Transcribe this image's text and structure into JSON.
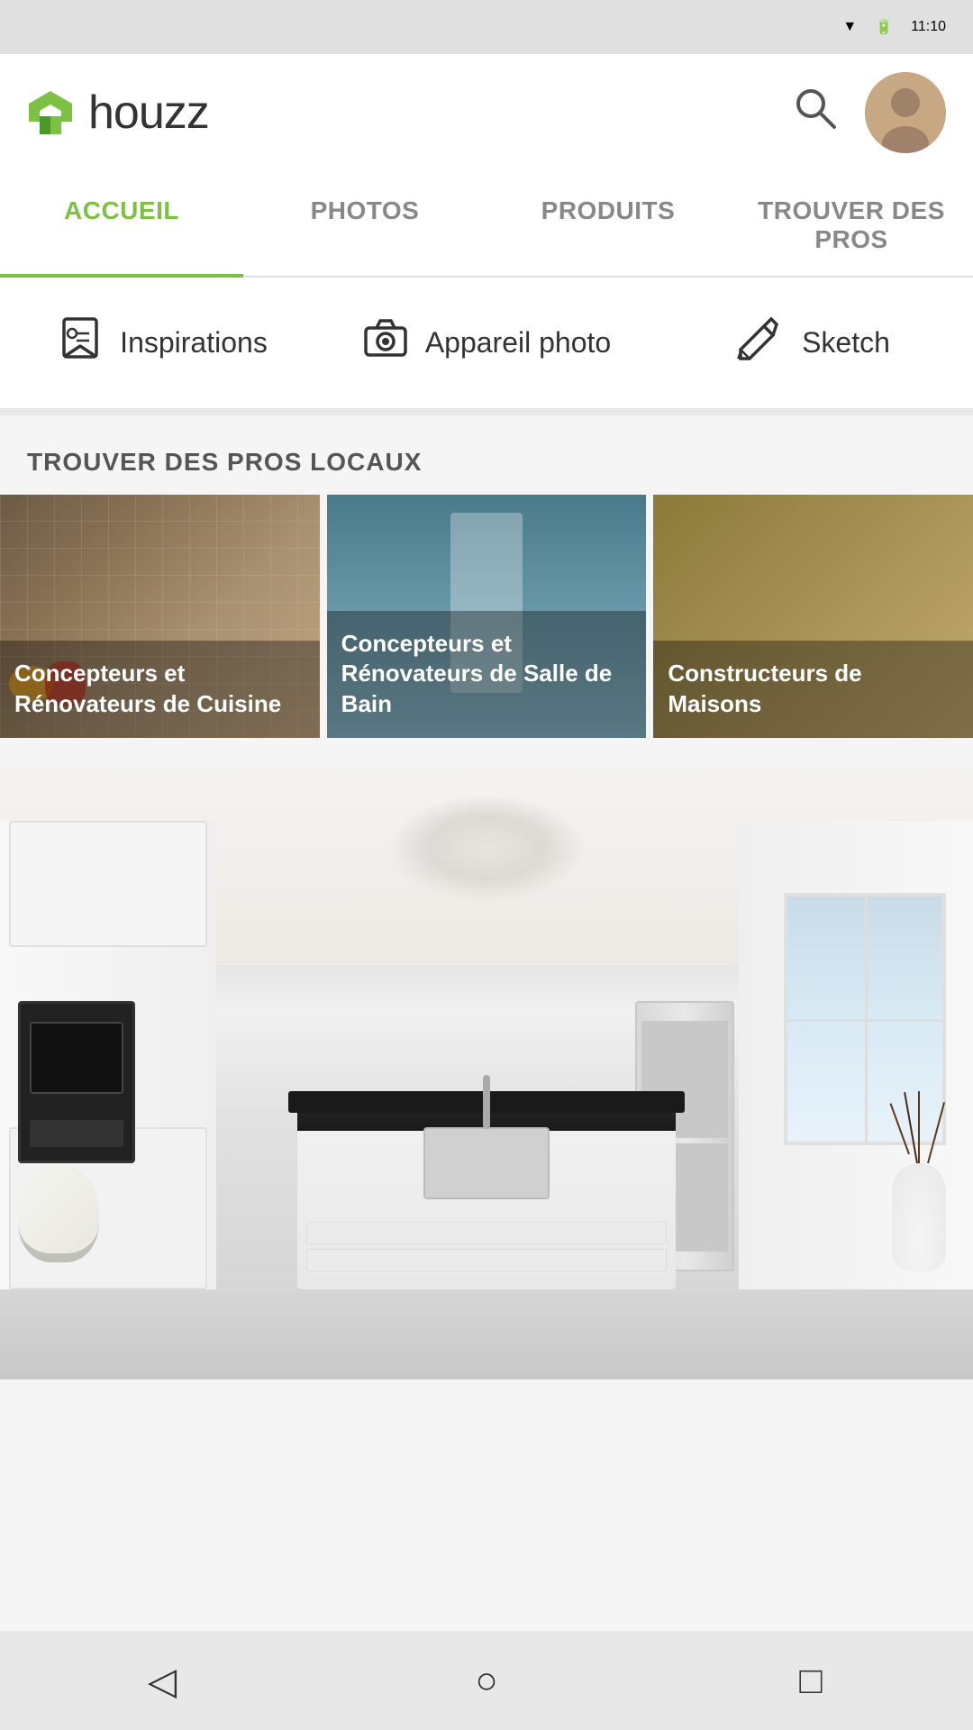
{
  "status_bar": {
    "time": "11:10"
  },
  "header": {
    "logo_text": "houzz",
    "search_icon": "🔍"
  },
  "nav": {
    "tabs": [
      {
        "id": "accueil",
        "label": "ACCUEIL",
        "active": true
      },
      {
        "id": "photos",
        "label": "PHOTOS",
        "active": false
      },
      {
        "id": "produits",
        "label": "PRODUITS",
        "active": false
      },
      {
        "id": "trouver",
        "label": "TROUVER DES PROS",
        "active": false
      }
    ]
  },
  "quick_actions": [
    {
      "id": "inspirations",
      "label": "Inspirations",
      "icon": "bookmark"
    },
    {
      "id": "appareil_photo",
      "label": "Appareil photo",
      "icon": "camera"
    },
    {
      "id": "sketch",
      "label": "Sketch",
      "icon": "pencil"
    }
  ],
  "pros_section": {
    "title": "TROUVER DES PROS LOCAUX",
    "cards": [
      {
        "id": "card1",
        "text": "Concepteurs et Rénovateurs de Cuisine"
      },
      {
        "id": "card2",
        "text": "Concepteurs et Rénovateurs de Salle de Bain"
      },
      {
        "id": "card3",
        "text": "Constructeurs de Maisons"
      }
    ]
  },
  "bottom_nav": {
    "back_icon": "◁",
    "home_icon": "○",
    "square_icon": "□"
  }
}
